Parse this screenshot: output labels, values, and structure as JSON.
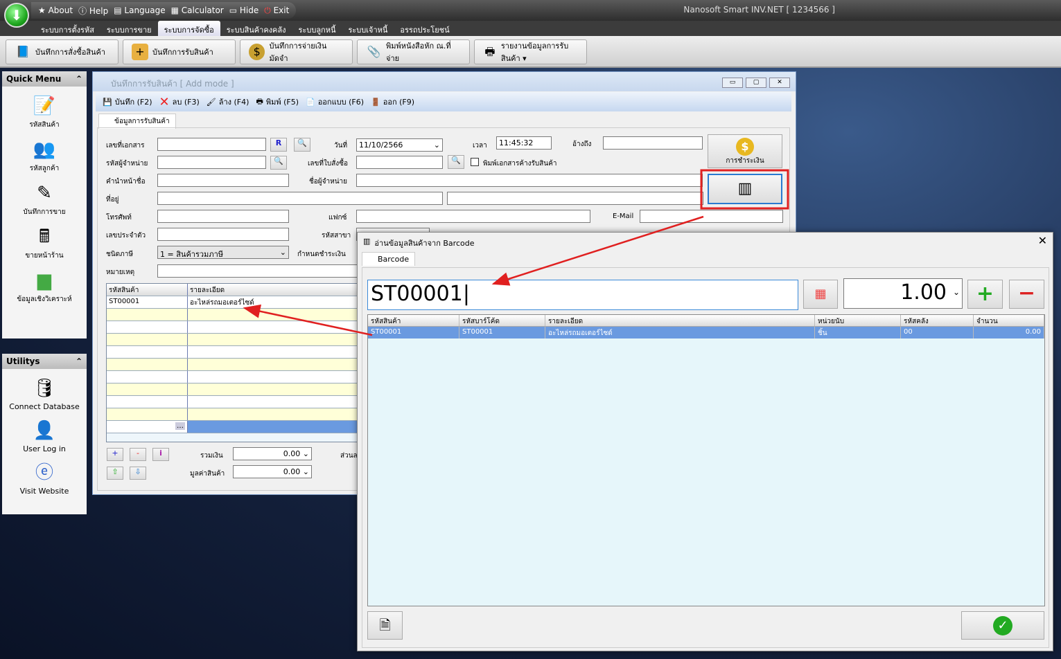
{
  "app": {
    "title": "Nanosoft Smart INV.NET  [ 1234566 ]",
    "quick_access": [
      {
        "icon": "star-icon",
        "label": "About"
      },
      {
        "icon": "help-icon",
        "label": "Help"
      },
      {
        "icon": "flag-icon",
        "label": "Language"
      },
      {
        "icon": "calculator-icon",
        "label": "Calculator"
      },
      {
        "icon": "monitor-icon",
        "label": "Hide"
      },
      {
        "icon": "power-icon",
        "label": "Exit"
      }
    ],
    "menu_tabs": [
      "ระบบการตั้งรหัส",
      "ระบบการขาย",
      "ระบบการจัดซื้อ",
      "ระบบสินค้าคงคลัง",
      "ระบบลูกหนี้",
      "ระบบเจ้าหนี้",
      "อรรถประโยชน์"
    ],
    "active_menu": "ระบบการจัดซื้อ",
    "ribbon": [
      {
        "icon": "book-icon",
        "label": "บันทึกการสั่งซื้อสินค้า"
      },
      {
        "icon": "box-add-icon",
        "label": "บันทึกการรับสินค้า"
      },
      {
        "icon": "money-bag-icon",
        "label": "บันทึกการจ่ายเงินมัดจำ"
      },
      {
        "icon": "paperclip-icon",
        "label": "พิมพ์หนังสือหัก ณ.ที่จ่าย"
      },
      {
        "icon": "printer-icon",
        "label": "รายงานข้อมูลการรับสินค้า ▾"
      }
    ]
  },
  "sidebar": {
    "quick_title": "Quick Menu",
    "quick_items": [
      {
        "icon": "product-icon",
        "label": "รหัสสินค้า"
      },
      {
        "icon": "customers-icon",
        "label": "รหัสลูกค้า"
      },
      {
        "icon": "sales-record-icon",
        "label": "บันทึกการขาย"
      },
      {
        "icon": "cash-register-icon",
        "label": "ขายหน้าร้าน"
      },
      {
        "icon": "bar-chart-icon",
        "label": "ข้อมูลเชิงวิเคราะห์"
      }
    ],
    "util_title": "Utilitys",
    "util_items": [
      {
        "icon": "database-icon",
        "label": "Connect Database"
      },
      {
        "icon": "user-login-icon",
        "label": "User Log in"
      },
      {
        "icon": "ie-icon",
        "label": "Visit Website"
      }
    ]
  },
  "form": {
    "title": "บันทึกการรับสินค้า [ Add mode ]",
    "toolbar": [
      "บันทึก (F2)",
      "ลบ (F3)",
      "ล้าง (F4)",
      "พิมพ์ (F5)",
      "ออกแบบ (F6)",
      "ออก (F9)"
    ],
    "tab": "ข้อมูลการรับสินค้า",
    "labels": {
      "doc_no": "เลขที่เอกสาร",
      "supplier_code": "รหัสผู้จำหน่าย",
      "prefix": "คำนำหน้าชื่อ",
      "address": "ที่อยู่",
      "phone": "โทรศัพท์",
      "tax_id": "เลขประจำตัว",
      "tax_type": "ชนิดภาษี",
      "note": "หมายเหตุ",
      "date": "วันที่",
      "po_no": "เลขที่ใบสั่งซื้อ",
      "supplier_name": "ชื่อผู้จำหน่าย",
      "fax": "แฟกซ์",
      "branch": "รหัสสาขา",
      "due": "กำหนดชำระเงิน",
      "time": "เวลา",
      "ref": "อ้างถึง",
      "email": "E-Mail",
      "print_pending": "พิมพ์เอกสารค้างรับสินค้า",
      "payment": "การชำระเงิน",
      "r": "R",
      "total": "รวมเงิน",
      "goods_value": "มูลค่าสินค้า",
      "discount": "ส่วนล"
    },
    "values": {
      "date": "11/10/2566",
      "time": "11:45:32",
      "tax_type": "1 = สินค้ารวมภาษี",
      "total": "0.00",
      "goods_value": "0.00"
    },
    "grid": {
      "columns": [
        "รหัสสินค้า",
        "รายละเอียด"
      ],
      "rows": [
        [
          "ST00001",
          "อะไหล่รถมอเตอร์ไซด์"
        ]
      ]
    }
  },
  "dialog": {
    "title": "อ่านข้อมูลสินค้าจาก Barcode",
    "tab": "Barcode",
    "barcode_value": "ST00001",
    "quantity": "1.00",
    "columns": [
      "รหัสสินค้า",
      "รหัสบาร์โค้ด",
      "รายละเอียด",
      "หน่วยนับ",
      "รหัสคลัง",
      "จำนวน"
    ],
    "rows": [
      [
        "ST00001",
        "ST00001",
        "อะไหล่รถมอเตอร์ไซด์",
        "ชิ้น",
        "00",
        "0.00"
      ]
    ]
  },
  "colors": {
    "annotation": "#e02020",
    "selected_row": "#6a9ae0",
    "alt_row": "#ffffd8"
  }
}
